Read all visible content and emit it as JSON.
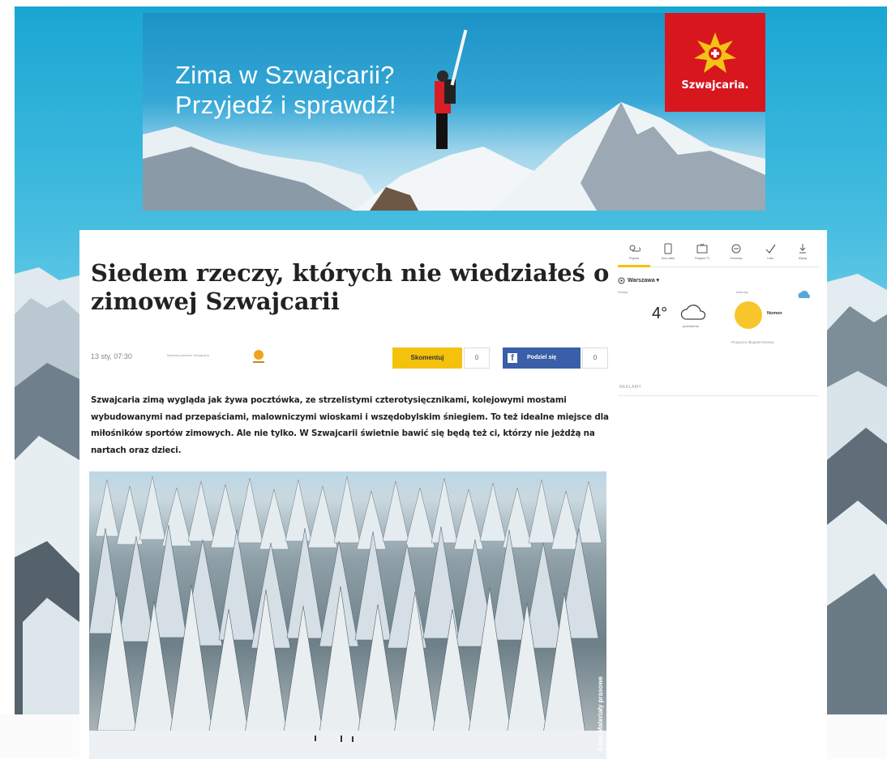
{
  "ad": {
    "headline_line1": "Zima w Szwajcarii?",
    "headline_line2": "Przyjedź i sprawdź!",
    "brand": "Szwajcaria.",
    "brand_color": "#d8161e"
  },
  "article": {
    "title": "Siedem rzeczy, których nie wiedziałeś o zimowej Szwajcarii",
    "date": "13 sty, 07:30",
    "partner_text": "Materiał partnera: Szwajcaria",
    "comment_label": "Skomentuj",
    "comment_count": "0",
    "share_label": "Podziel się",
    "share_count": "0",
    "lead": "Szwajcaria zimą wygląda jak żywa pocztówka, ze strzelistymi czterotysięcznikami, kolejowymi mostami wybudowanymi nad przepaściami, malowniczymi wioskami i wszędobylskim śniegiem. To też idealne miejsce dla miłośników sportów zimowych. Ale nie tylko. W Szwajcarii świetnie bawić się będą też ci, którzy nie jeżdżą na nartach oraz dzieci.",
    "photo_credit": "Foto: Materiały prasowe"
  },
  "sidebar": {
    "services": [
      {
        "label": "Pogoda",
        "icon": "weather-icon"
      },
      {
        "label": "Kurs walut",
        "icon": "currency-icon"
      },
      {
        "label": "Program TV",
        "icon": "tv-icon"
      },
      {
        "label": "Horoskop",
        "icon": "horoscope-icon"
      },
      {
        "label": "Lotto",
        "icon": "lotto-icon"
      },
      {
        "label": "Więcej",
        "icon": "more-icon"
      }
    ],
    "city": "Warszawa ▾",
    "weather_sub": "Dzisiaj",
    "temperature": "4°",
    "weather_desc": "pochmurno",
    "nameday_label": "Imieniny",
    "nameday_name": "Nomen",
    "forecast_link": "Prognoza długoterminowa",
    "ads_label": "REKLAMY",
    "accent_color": "#f4c20d"
  }
}
